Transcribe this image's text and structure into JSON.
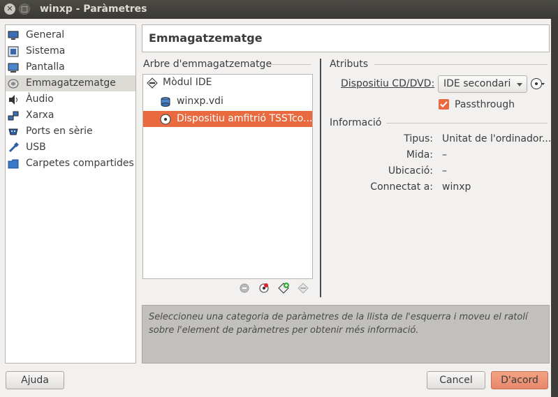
{
  "window": {
    "title": "winxp - Paràmetres",
    "close_glyph": "✕",
    "maximize_glyph": "□"
  },
  "sidebar": {
    "items": [
      {
        "label": "General",
        "icon": "monitor-icon"
      },
      {
        "label": "Sistema",
        "icon": "chip-icon"
      },
      {
        "label": "Pantalla",
        "icon": "display-icon"
      },
      {
        "label": "Emmagatzematge",
        "icon": "disk-icon",
        "selected": true
      },
      {
        "label": "Àudio",
        "icon": "speaker-icon"
      },
      {
        "label": "Xarxa",
        "icon": "network-icon"
      },
      {
        "label": "Ports en sèrie",
        "icon": "serial-port-icon"
      },
      {
        "label": "USB",
        "icon": "usb-icon"
      },
      {
        "label": "Carpetes compartides",
        "icon": "folder-icon"
      }
    ]
  },
  "page": {
    "title": "Emmagatzematge"
  },
  "tree": {
    "group_label": "Arbre d'emmagatzematge",
    "controller": "Mòdul IDE",
    "items": [
      {
        "label": "winxp.vdi",
        "icon": "hard-disk-icon"
      },
      {
        "label": "Dispositiu amfitrió TSSTco...",
        "icon": "optical-disc-icon",
        "selected": true
      }
    ]
  },
  "attributes": {
    "group_label": "Atributs",
    "cd_dvd_label": "Dispositiu CD/DVD:",
    "cd_dvd_value": "IDE secondari m",
    "passthrough_label": "Passthrough",
    "passthrough_checked": true
  },
  "information": {
    "group_label": "Informació",
    "rows": [
      {
        "label": "Tipus:",
        "value": "Unitat de l'ordinador..."
      },
      {
        "label": "Mida:",
        "value": "–"
      },
      {
        "label": "Ubicació:",
        "value": "–"
      },
      {
        "label": "Connectat a:",
        "value": "winxp"
      }
    ]
  },
  "hint": "Seleccioneu una categoria de paràmetres de la llista de l'esquerra i moveu el ratolí sobre l'element de paràmetres per obtenir més informació.",
  "buttons": {
    "help": "Ajuda",
    "cancel": "Cancel",
    "ok": "D'acord"
  },
  "colors": {
    "accent": "#e86a3e",
    "titlebar": "#3e3d39"
  }
}
